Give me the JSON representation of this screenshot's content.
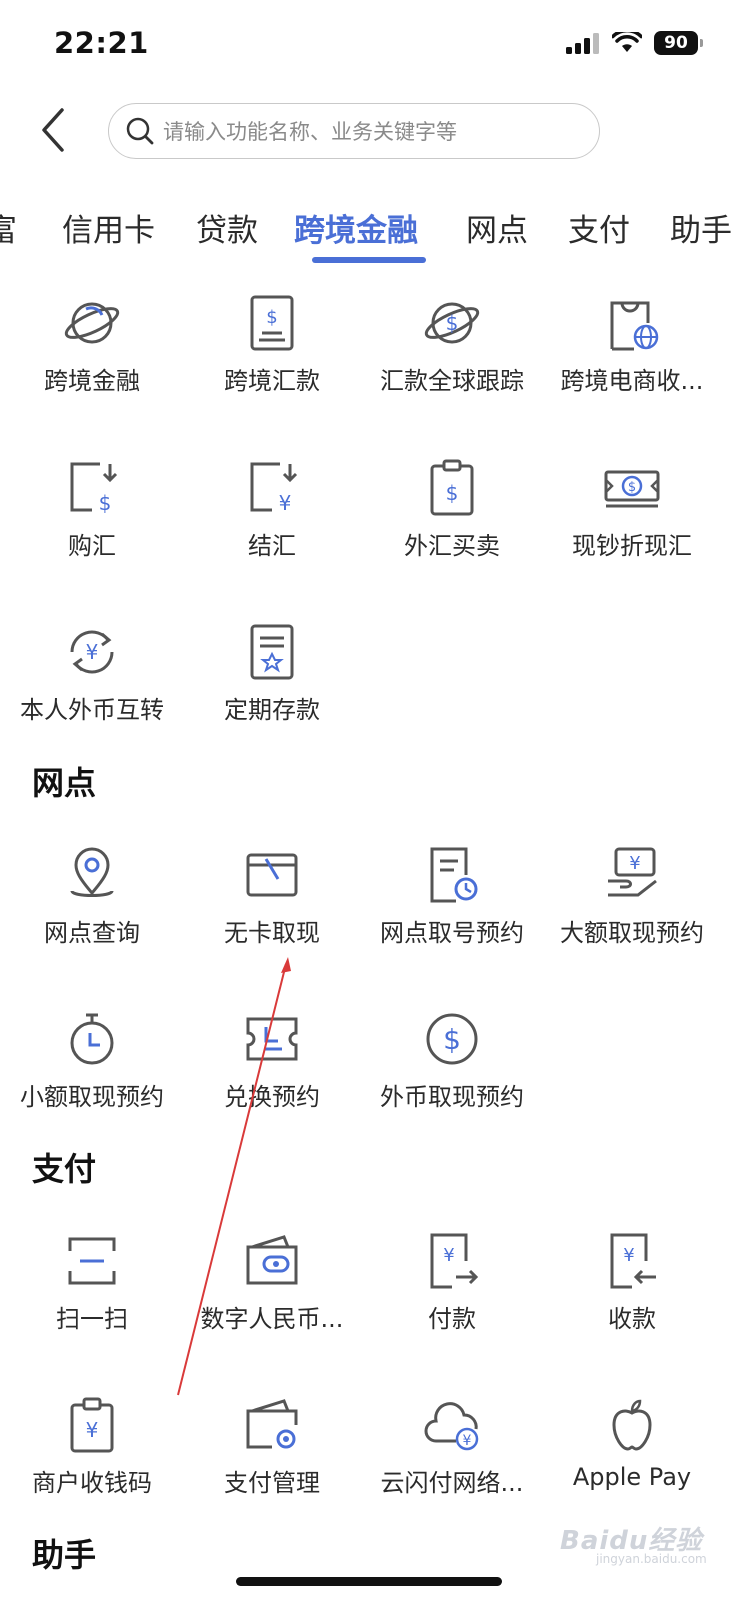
{
  "status_bar": {
    "time": "22:21",
    "battery": "90"
  },
  "search": {
    "placeholder": "请输入功能名称、业务关键字等"
  },
  "tabs": [
    {
      "label": "富"
    },
    {
      "label": "信用卡"
    },
    {
      "label": "贷款"
    },
    {
      "label": "跨境金融",
      "active": true
    },
    {
      "label": "网点"
    },
    {
      "label": "支付"
    },
    {
      "label": "助手"
    }
  ],
  "cross_border": {
    "items": [
      {
        "label": "跨境金融",
        "icon": "planet-icon"
      },
      {
        "label": "跨境汇款",
        "icon": "remittance-document-icon"
      },
      {
        "label": "汇款全球跟踪",
        "icon": "global-tracking-icon"
      },
      {
        "label": "跨境电商收...",
        "icon": "ecommerce-bag-icon"
      },
      {
        "label": "购汇",
        "icon": "buy-forex-icon"
      },
      {
        "label": "结汇",
        "icon": "settle-forex-icon"
      },
      {
        "label": "外汇买卖",
        "icon": "forex-trade-icon"
      },
      {
        "label": "现钞折现汇",
        "icon": "banknote-icon"
      },
      {
        "label": "本人外币互转",
        "icon": "currency-exchange-icon"
      },
      {
        "label": "定期存款",
        "icon": "fixed-deposit-icon"
      }
    ]
  },
  "branch": {
    "title": "网点",
    "items": [
      {
        "label": "网点查询",
        "icon": "location-pin-icon"
      },
      {
        "label": "无卡取现",
        "icon": "cardless-withdrawal-icon"
      },
      {
        "label": "网点取号预约",
        "icon": "queue-ticket-icon"
      },
      {
        "label": "大额取现预约",
        "icon": "large-cash-icon"
      },
      {
        "label": "小额取现预约",
        "icon": "stopwatch-icon"
      },
      {
        "label": "兑换预约",
        "icon": "coupon-ticket-icon"
      },
      {
        "label": "外币取现预约",
        "icon": "dollar-coin-icon"
      }
    ]
  },
  "payment": {
    "title": "支付",
    "items": [
      {
        "label": "扫一扫",
        "icon": "scan-icon"
      },
      {
        "label": "数字人民币...",
        "icon": "wallet-icon"
      },
      {
        "label": "付款",
        "icon": "pay-icon"
      },
      {
        "label": "收款",
        "icon": "receive-icon"
      },
      {
        "label": "商户收钱码",
        "icon": "merchant-code-icon"
      },
      {
        "label": "支付管理",
        "icon": "payment-settings-icon"
      },
      {
        "label": "云闪付网络...",
        "icon": "cloud-pay-icon"
      },
      {
        "label": "Apple Pay",
        "icon": "apple-icon"
      }
    ]
  },
  "assistant": {
    "title": "助手"
  },
  "watermark": {
    "text": "Baidu经验",
    "sub": "jingyan.baidu.com"
  },
  "colors": {
    "accent": "#4a6fd6",
    "icon_stroke": "#555555",
    "annotation": "#d93a3a"
  }
}
